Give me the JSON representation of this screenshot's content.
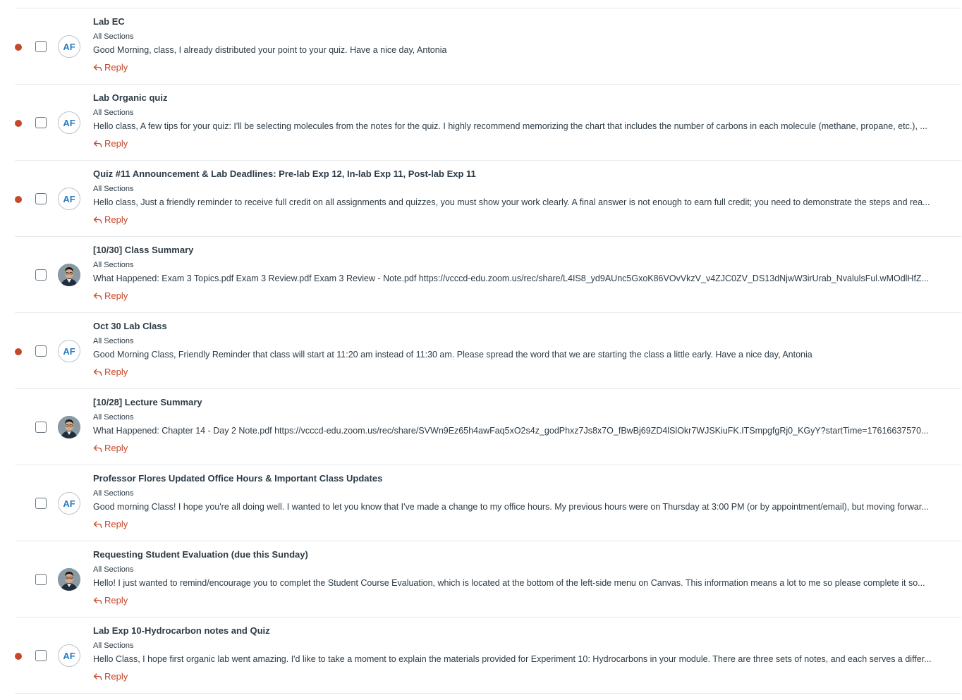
{
  "reply_label": "Reply",
  "colors": {
    "unread": "#c7472a",
    "reply": "#c7472a",
    "avatar_initials": "#2b7abc",
    "text": "#2d3b45",
    "divider": "#e6e9ec"
  },
  "announcements": [
    {
      "title": "Lab EC",
      "sections": "All Sections",
      "message": "Good Morning, class, I already distributed your point to your quiz. Have a nice day, Antonia",
      "unread": true,
      "avatar": {
        "type": "initials",
        "text": "AF"
      }
    },
    {
      "title": "Lab Organic quiz",
      "sections": "All Sections",
      "message": "Hello class,   A few tips for your quiz: I'll be selecting molecules from the notes for the quiz. I highly recommend memorizing the chart that includes the number of carbons in each molecule (methane, propane, etc.), ...",
      "unread": true,
      "avatar": {
        "type": "initials",
        "text": "AF"
      }
    },
    {
      "title": "Quiz #11 Announcement & Lab Deadlines: Pre-lab Exp 12, In-lab Exp 11, Post-lab Exp 11",
      "sections": "All Sections",
      "message": "Hello class, Just a friendly reminder to receive full credit on all assignments and quizzes, you must show your work clearly. A final answer is not enough to earn full credit; you need to demonstrate the steps and rea...",
      "unread": true,
      "avatar": {
        "type": "initials",
        "text": "AF"
      }
    },
    {
      "title": "[10/30] Class Summary",
      "sections": "All Sections",
      "message": "What Happened: Exam 3 Topics.pdf Exam 3 Review.pdf Exam 3 Review - Note.pdf https://vcccd-edu.zoom.us/rec/share/L4IS8_yd9AUnc5GxoK86VOvVkzV_v4ZJC0ZV_DS13dNjwW3irUrab_NvalulsFul.wMOdlHfZ...",
      "unread": false,
      "avatar": {
        "type": "photo",
        "text": ""
      }
    },
    {
      "title": "Oct 30 Lab Class",
      "sections": "All Sections",
      "message": "Good Morning Class, Friendly Reminder that class will start at 11:20 am instead of 11:30 am. Please spread the word that we are starting the class a little early.  Have a nice day, Antonia",
      "unread": true,
      "avatar": {
        "type": "initials",
        "text": "AF"
      }
    },
    {
      "title": "[10/28] Lecture Summary",
      "sections": "All Sections",
      "message": "What Happened: Chapter 14 - Day 2 Note.pdf https://vcccd-edu.zoom.us/rec/share/SVWn9Ez65h4awFaq5xO2s4z_godPhxz7Js8x7O_fBwBj69ZD4lSlOkr7WJSKiuFK.ITSmpgfgRj0_KGyY?startTime=17616637570...",
      "unread": false,
      "avatar": {
        "type": "photo",
        "text": ""
      }
    },
    {
      "title": "Professor Flores Updated Office Hours & Important Class Updates",
      "sections": "All Sections",
      "message": "Good morning Class! I hope you're all doing well. I wanted to let you know that I've made a change to my office hours. My previous hours were on Thursday at 3:00 PM (or by appointment/email), but moving forwar...",
      "unread": false,
      "avatar": {
        "type": "initials",
        "text": "AF"
      }
    },
    {
      "title": "Requesting Student Evaluation (due this Sunday)",
      "sections": "All Sections",
      "message": "Hello! I just wanted to remind/encourage you to complet the Student Course Evaluation, which is located at the bottom of the left-side menu on Canvas. This information means a lot to me so please complete it so...",
      "unread": false,
      "avatar": {
        "type": "photo",
        "text": ""
      }
    },
    {
      "title": "Lab Exp 10-Hydrocarbon notes and Quiz",
      "sections": "All Sections",
      "message": "Hello Class, I hope first organic lab went amazing. I'd like to take a moment to explain the materials provided for Experiment 10: Hydrocarbons in your module. There are three sets of notes, and each serves a differ...",
      "unread": true,
      "avatar": {
        "type": "initials",
        "text": "AF"
      }
    }
  ]
}
